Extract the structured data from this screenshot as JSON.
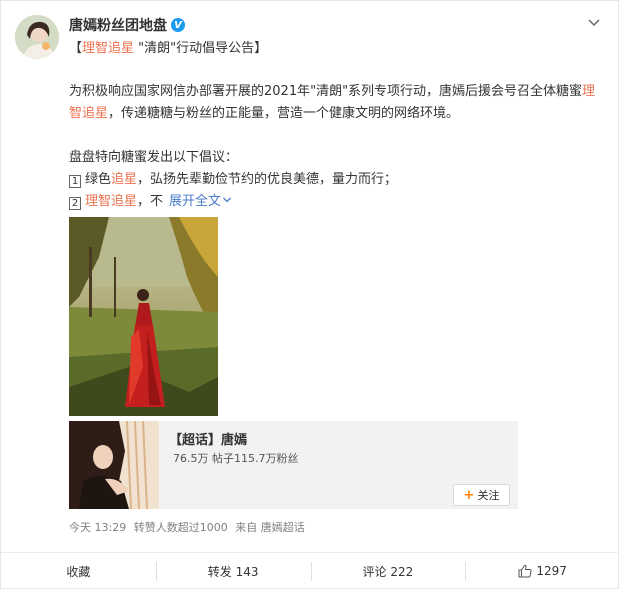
{
  "post": {
    "author": {
      "name": "唐嫣粉丝团地盘",
      "verified_badge": "V"
    },
    "topic_line": {
      "open_bracket": "【",
      "topic_tag": "理智追星",
      "quote_text": " \"清朗\"行动倡导公告",
      "close_bracket": "】"
    },
    "body": {
      "p1_a": "为积极响应国家网信办部署开展的2021年\"清朗\"系列专项行动，唐嫣后援会号召全体糖蜜",
      "p1_tag": "理智追星",
      "p1_b": "，传递糖糖与粉丝的正能量，营造一个健康文明的网络环境。",
      "p2": "盘盘特向糖蜜发出以下倡议：",
      "item1_num": "1",
      "item1_a": "绿色",
      "item1_tag": "追星",
      "item1_b": "，弘扬先辈勤俭节约的优良美德，量力而行；",
      "item2_num": "2",
      "item2_tag": "理智追星",
      "item2_b": "，不",
      "expand_label": "展开全文",
      "expand_icon": "chevron-down-icon"
    },
    "super_topic": {
      "title": "【超话】唐嫣",
      "stats": "76.5万 帖子115.7万粉丝",
      "follow_label": "关注",
      "follow_icon": "plus-icon"
    },
    "meta": {
      "time": "今天 13:29",
      "repost_note": "转赞人数超过1000",
      "source": "来自 唐嫣超话"
    },
    "actions": {
      "favorite": "收藏",
      "repost": "转发 143",
      "comment": "评论 222",
      "like": "1297"
    },
    "colors": {
      "tag_orange": "#eb7350",
      "link_blue": "#4a7bc8",
      "verified_blue": "#1a9bf0",
      "follow_plus": "#ff8200"
    }
  }
}
